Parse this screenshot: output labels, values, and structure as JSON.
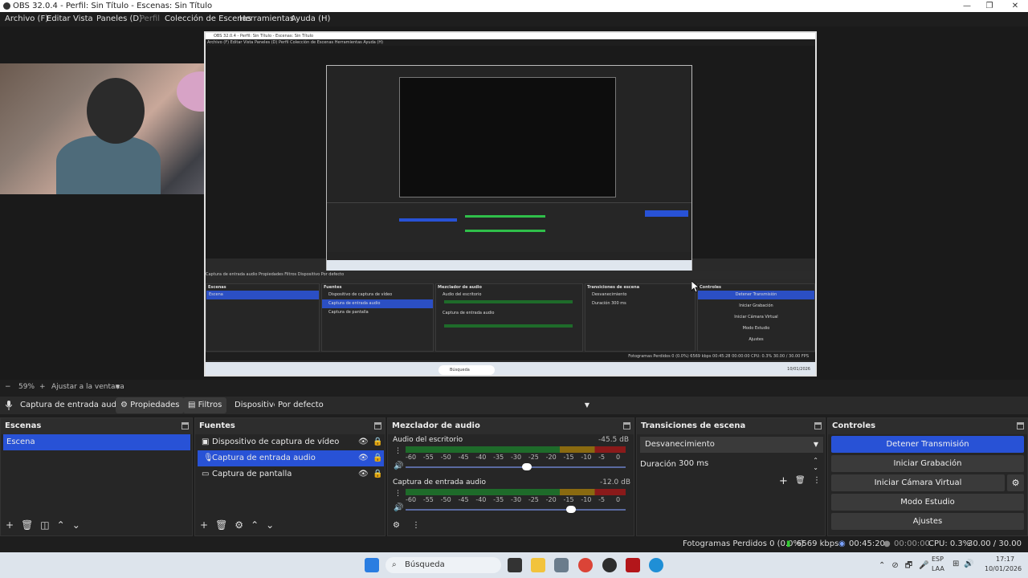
{
  "window": {
    "title": "OBS 32.0.4 - Perfil: Sin Título - Escenas: Sin Título",
    "controls": [
      "—",
      "❐",
      "✕"
    ]
  },
  "menu": {
    "items": [
      "Archivo (F)",
      "Editar",
      "Vista",
      "Paneles (D)",
      "Perfil",
      "Colección de Escenas",
      "Herramientas",
      "Ayuda (H)"
    ]
  },
  "preview": {
    "zoom": "59%",
    "fit_label": "Ajustar a la ventana"
  },
  "nested_capture": {
    "title": "OBS 32.0.4 - Perfil: Sin Título - Escenas: Sin Título",
    "menu": "Archivo (F)   Editar   Vista   Paneles (D)   Perfil   Colección de Escenas   Herramientas   Ayuda (H)",
    "panelbar": "Captura de entrada audio    Propiedades    Filtros    Dispositivo   Por defecto",
    "scenes_header": "Escenas",
    "scene": "Escena",
    "sources_header": "Fuentes",
    "sources": [
      "Dispositivo de captura de vídeo",
      "Captura de entrada audio",
      "Captura de pantalla"
    ],
    "mixer_header": "Mezclador de audio",
    "mixer_ch1": "Audio del escritorio",
    "mixer_ch2": "Captura de entrada audio",
    "transitions_header": "Transiciones de escena",
    "transition": "Desvanecimiento",
    "duration": "Duración   300 ms",
    "controls_header": "Controles",
    "controls": [
      "Detener Transmisión",
      "Iniciar Grabación",
      "Iniciar Cámara Virtual",
      "Modo Estudio",
      "Ajustes"
    ],
    "status": "Fotogramas Perdidos 0 (0.0%)   6569 kbps   00:45:28   00:00:00   CPU: 0.3%   30.00 / 30.00 FPS",
    "search": "Búsqueda",
    "date": "10/01/2026"
  },
  "source_toolbar": {
    "source_name": "Captura de entrada audio",
    "properties_label": "Propiedades",
    "filters_label": "Filtros",
    "device_label": "Dispositivo",
    "device_value": "Por defecto"
  },
  "scenes": {
    "header": "Escenas",
    "items": [
      {
        "label": "Escena",
        "selected": true
      }
    ]
  },
  "sources": {
    "header": "Fuentes",
    "items": [
      {
        "label": "Dispositivo de captura de vídeo",
        "icon": "camera-icon",
        "selected": false
      },
      {
        "label": "Captura de entrada audio",
        "icon": "microphone-icon",
        "selected": true
      },
      {
        "label": "Captura de pantalla",
        "icon": "monitor-icon",
        "selected": false
      }
    ]
  },
  "mixer": {
    "header": "Mezclador de audio",
    "channels": [
      {
        "name": "Audio del escritorio",
        "db": "-45.5 dB",
        "level": 0.0,
        "volume": 0.55
      },
      {
        "name": "Captura de entrada audio",
        "db": "-12.0 dB",
        "level": 0.0,
        "volume": 0.75
      }
    ],
    "ticks": [
      "-60",
      "-55",
      "-50",
      "-45",
      "-40",
      "-35",
      "-30",
      "-25",
      "-20",
      "-15",
      "-10",
      "-5",
      "0"
    ]
  },
  "transitions": {
    "header": "Transiciones de escena",
    "selected": "Desvanecimiento",
    "duration_label": "Duración",
    "duration_value": "300 ms"
  },
  "controls": {
    "header": "Controles",
    "stop_stream": "Detener Transmisión",
    "start_record": "Iniciar Grabación",
    "start_virtualcam": "Iniciar Cámara Virtual",
    "studio_mode": "Modo Estudio",
    "settings": "Ajustes"
  },
  "status": {
    "dropped_frames": "Fotogramas Perdidos 0 (0.0%)",
    "bitrate": "6569 kbps",
    "stream_time": "00:45:20",
    "record_time": "00:00:00",
    "cpu": "CPU: 0.3%",
    "fps": "30.00 / 30.00 FPS"
  },
  "taskbar": {
    "search_placeholder": "Búsqueda",
    "lang_top": "ESP",
    "lang_bottom": "LAA",
    "time": "17:17",
    "date": "10/01/2026"
  },
  "colors": {
    "accent": "#2852d6",
    "panel_bg": "#262626",
    "app_bg": "#1e1e1e",
    "meter_green": "#2fbf4a",
    "meter_yellow": "#ffd400",
    "meter_red": "#c8202a"
  }
}
